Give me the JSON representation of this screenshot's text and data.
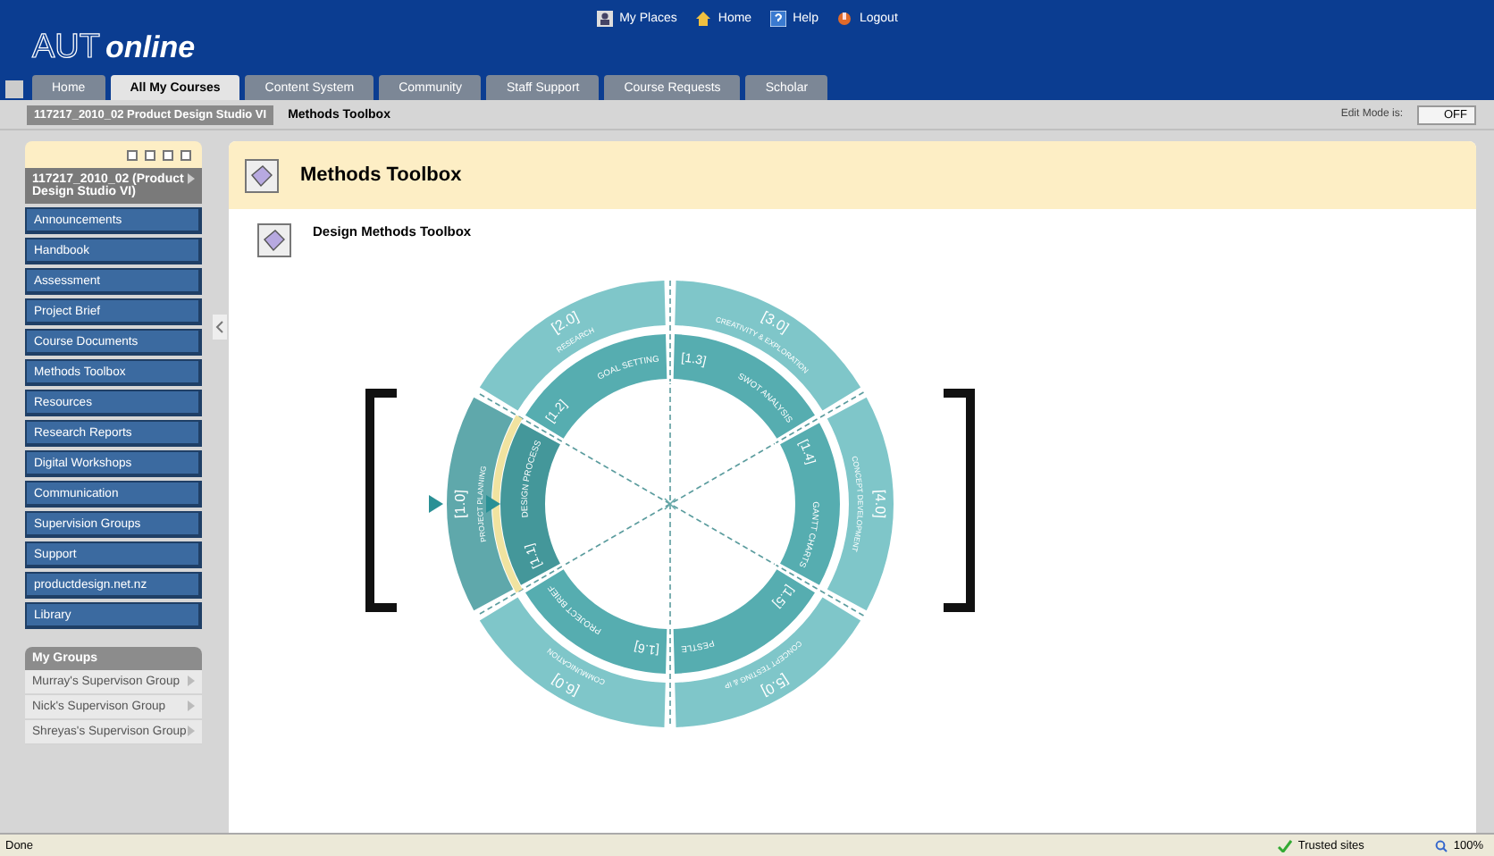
{
  "header": {
    "logo_main": "AUT",
    "logo_sub": "online",
    "links": [
      {
        "label": "My Places"
      },
      {
        "label": "Home"
      },
      {
        "label": "Help"
      },
      {
        "label": "Logout"
      }
    ]
  },
  "tabs": [
    {
      "label": "Home",
      "selected": false
    },
    {
      "label": "All My Courses",
      "selected": true
    },
    {
      "label": "Content System",
      "selected": false
    },
    {
      "label": "Community",
      "selected": false
    },
    {
      "label": "Staff Support",
      "selected": false
    },
    {
      "label": "Course Requests",
      "selected": false
    },
    {
      "label": "Scholar",
      "selected": false
    }
  ],
  "breadcrumb": {
    "course": "117217_2010_02 Product Design Studio VI",
    "page": "Methods Toolbox",
    "edit_label": "Edit Mode is:",
    "edit_value": "OFF"
  },
  "sidebar": {
    "course": "117217_2010_02 (Product Design Studio VI)",
    "items": [
      {
        "label": "Announcements"
      },
      {
        "label": "Handbook"
      },
      {
        "label": "Assessment"
      },
      {
        "label": "Project Brief"
      },
      {
        "label": "Course Documents"
      },
      {
        "label": "Methods Toolbox"
      },
      {
        "label": "Resources"
      },
      {
        "label": "Research Reports"
      },
      {
        "label": "Digital Workshops"
      },
      {
        "label": "Communication"
      },
      {
        "label": "Supervision Groups"
      },
      {
        "label": "Support"
      },
      {
        "label": "productdesign.net.nz"
      },
      {
        "label": "Library"
      }
    ],
    "groups_title": "My Groups",
    "groups": [
      {
        "label": "Murray's Supervison Group"
      },
      {
        "label": "Nick's Supervison Group"
      },
      {
        "label": "Shreyas's Supervison Group"
      }
    ]
  },
  "content": {
    "title": "Methods Toolbox",
    "item_title": "Design Methods Toolbox",
    "wheel": {
      "outer": [
        {
          "number": "[2.0]",
          "name": "RESEARCH",
          "selected": false
        },
        {
          "number": "[3.0]",
          "name": "CREATIVITY & EXPLORATION",
          "selected": false
        },
        {
          "number": "[1.0]",
          "name": "PROJECT PLANNING",
          "selected": true
        },
        {
          "number": "[4.0]",
          "name": "CONCEPT DEVELOPMENT",
          "selected": false
        },
        {
          "number": "[6.0]",
          "name": "COMMUNICATION",
          "selected": false
        },
        {
          "number": "[5.0]",
          "name": "CONCEPT TESTING & IP",
          "selected": false
        }
      ],
      "inner": [
        {
          "number": "[1.2]",
          "name": "GOAL SETTING",
          "selected": false
        },
        {
          "number": "[1.3]",
          "name": "SWOT ANALYSIS",
          "selected": false
        },
        {
          "number": "[1.1]",
          "name": "DESIGN PROCESS",
          "selected": true
        },
        {
          "number": "[1.4]",
          "name": "GANTT CHARTS",
          "selected": false
        },
        {
          "number": "[1.6]",
          "name": "PROJECT BRIEF",
          "selected": false
        },
        {
          "number": "[1.5]",
          "name": "PESTLE",
          "selected": false
        }
      ]
    }
  },
  "status_bar": {
    "text": "Done",
    "zone": "Trusted sites",
    "zoom": "100%"
  }
}
